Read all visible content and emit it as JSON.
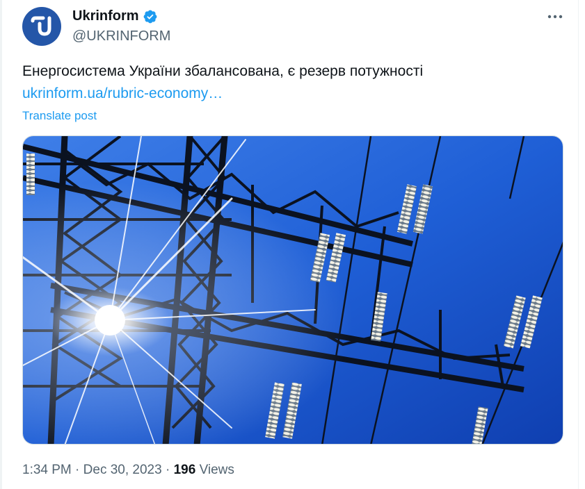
{
  "post": {
    "author": {
      "display_name": "Ukrinform",
      "handle": "@UKRINFORM",
      "verified": true,
      "avatar_color": "#2456a8",
      "avatar_icon": "ukrinform-logo-icon"
    },
    "text": "Енергосистема України збалансована, є резерв потужності",
    "link_text": "ukrinform.ua/rubric-economy…",
    "translate_label": "Translate post",
    "more_icon": "more-horizontal-icon",
    "media": {
      "type": "photo",
      "subject": "power-transmission-tower-against-blue-sky-with-sun-flare"
    },
    "meta": {
      "time": "1:34 PM",
      "separator": "·",
      "date": "Dec 30, 2023",
      "views_count": "196",
      "views_label": "Views"
    }
  },
  "colors": {
    "accent": "#1d9bf0",
    "text_primary": "#0f1419",
    "text_secondary": "#536471",
    "verified": "#1d9bf0"
  }
}
